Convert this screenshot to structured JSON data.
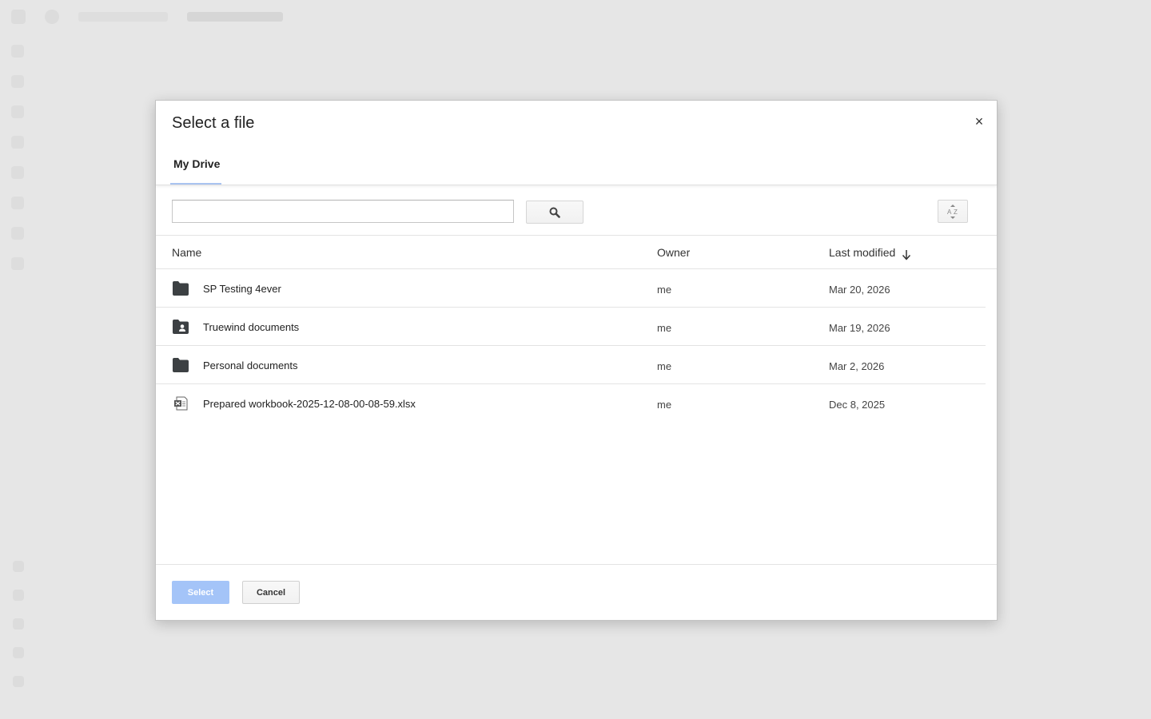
{
  "dialog": {
    "title": "Select a file",
    "close_icon": "close-icon"
  },
  "tabs": [
    {
      "label": "My Drive",
      "active": true
    }
  ],
  "search": {
    "value": "",
    "placeholder": "",
    "button_icon": "search-icon"
  },
  "sort": {
    "icon": "sort-az-icon"
  },
  "columns": {
    "name": "Name",
    "owner": "Owner",
    "modified": "Last modified",
    "sort_direction_icon": "arrow-down-icon"
  },
  "files": [
    {
      "name": "SP Testing 4ever",
      "owner": "me",
      "modified": "Mar 20, 2026",
      "icon": "folder-icon"
    },
    {
      "name": "Truewind documents",
      "owner": "me",
      "modified": "Mar 19, 2026",
      "icon": "shared-folder-icon"
    },
    {
      "name": "Personal documents",
      "owner": "me",
      "modified": "Mar 2, 2026",
      "icon": "folder-icon"
    },
    {
      "name": "Prepared workbook-2025-12-08-00-08-59.xlsx",
      "owner": "me",
      "modified": "Dec 8, 2025",
      "icon": "excel-file-icon"
    }
  ],
  "footer": {
    "select_label": "Select",
    "cancel_label": "Cancel"
  },
  "colors": {
    "tab_underline": "#a9c3f0",
    "select_button": "#a4c4f8",
    "folder_icon": "#3c4043"
  }
}
